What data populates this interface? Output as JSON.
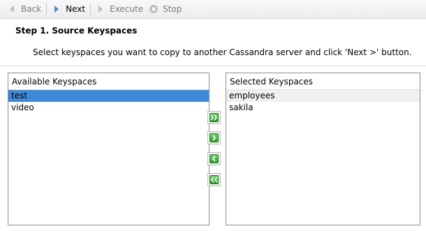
{
  "toolbar": {
    "back_label": "Back",
    "next_label": "Next",
    "execute_label": "Execute",
    "stop_label": "Stop"
  },
  "step": {
    "title": "Step 1. Source Keyspaces",
    "description": "Select keyspaces you want to copy to another Cassandra server and click 'Next >' button."
  },
  "available": {
    "header": "Available Keyspaces",
    "items": [
      "test",
      "video"
    ],
    "selected_index": 0
  },
  "selected": {
    "header": "Selected Keyspaces",
    "items": [
      "employees",
      "sakila"
    ]
  },
  "colors": {
    "selection": "#3f8ad8",
    "button_green": "#2e9a2b"
  }
}
